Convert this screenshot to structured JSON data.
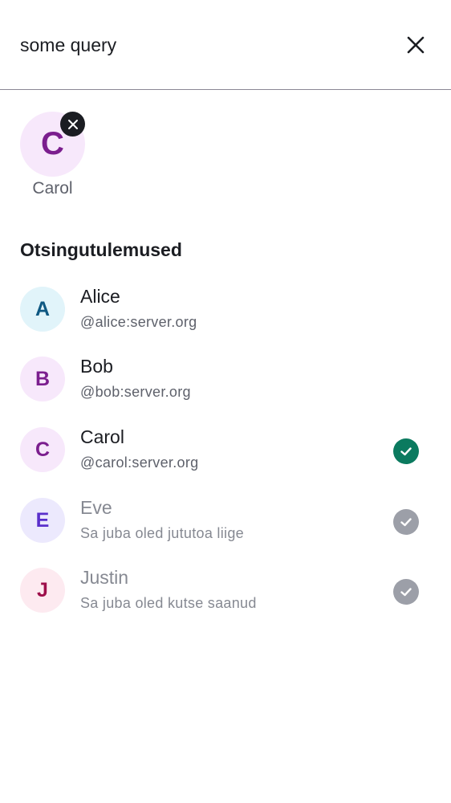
{
  "search": {
    "value": "some query",
    "placeholder": ""
  },
  "selected": {
    "avatar_letter": "C",
    "label": "Carol"
  },
  "results": {
    "title": "Otsingutulemused",
    "rows": [
      {
        "letter": "A",
        "name": "Alice",
        "subtitle": "@alice:server.org",
        "status": "none"
      },
      {
        "letter": "B",
        "name": "Bob",
        "subtitle": "@bob:server.org",
        "status": "none"
      },
      {
        "letter": "C",
        "name": "Carol",
        "subtitle": "@carol:server.org",
        "status": "selected"
      },
      {
        "letter": "E",
        "name": "Eve",
        "subtitle": "Sa juba oled jututoa liige",
        "status": "joined"
      },
      {
        "letter": "J",
        "name": "Justin",
        "subtitle": "Sa juba oled kutse saanud",
        "status": "invited"
      }
    ]
  },
  "icons": {
    "clear": "close-icon",
    "chip_remove": "close-icon",
    "check": "check-icon"
  },
  "colors": {
    "selected_check": "#0b7a5f",
    "disabled_check": "#9c9fa8",
    "avatar_a_bg": "#e1f4fa",
    "avatar_a_fg": "#0e5882",
    "avatar_b_bg": "#f7e8fb",
    "avatar_b_fg": "#7b1e8e",
    "avatar_c_bg": "#f7e8fb",
    "avatar_c_fg": "#7b1e8e",
    "avatar_e_bg": "#ece9fd",
    "avatar_e_fg": "#5a2fcb",
    "avatar_j_bg": "#fdeaf0",
    "avatar_j_fg": "#9e0f4b"
  }
}
